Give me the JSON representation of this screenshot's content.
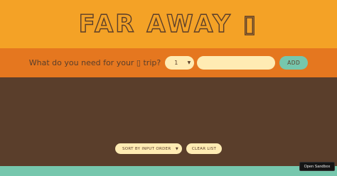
{
  "header": {
    "logo_text": "FAR AWAY ▯"
  },
  "add_form": {
    "prompt": "What do you need for your ▯ trip?",
    "quantity_value": "1",
    "item_input_value": "",
    "add_label": "ADD"
  },
  "actions": {
    "sort_value": "SORT BY INPUT ORDER",
    "clear_label": "CLEAR LIST"
  },
  "sandbox": {
    "label": "Open Sandbox"
  },
  "colors": {
    "header_bg": "#f4a226",
    "form_bg": "#e5771f",
    "list_bg": "#5a3e2b",
    "stats_bg": "#76c7ad",
    "cream": "#ffebb3"
  }
}
